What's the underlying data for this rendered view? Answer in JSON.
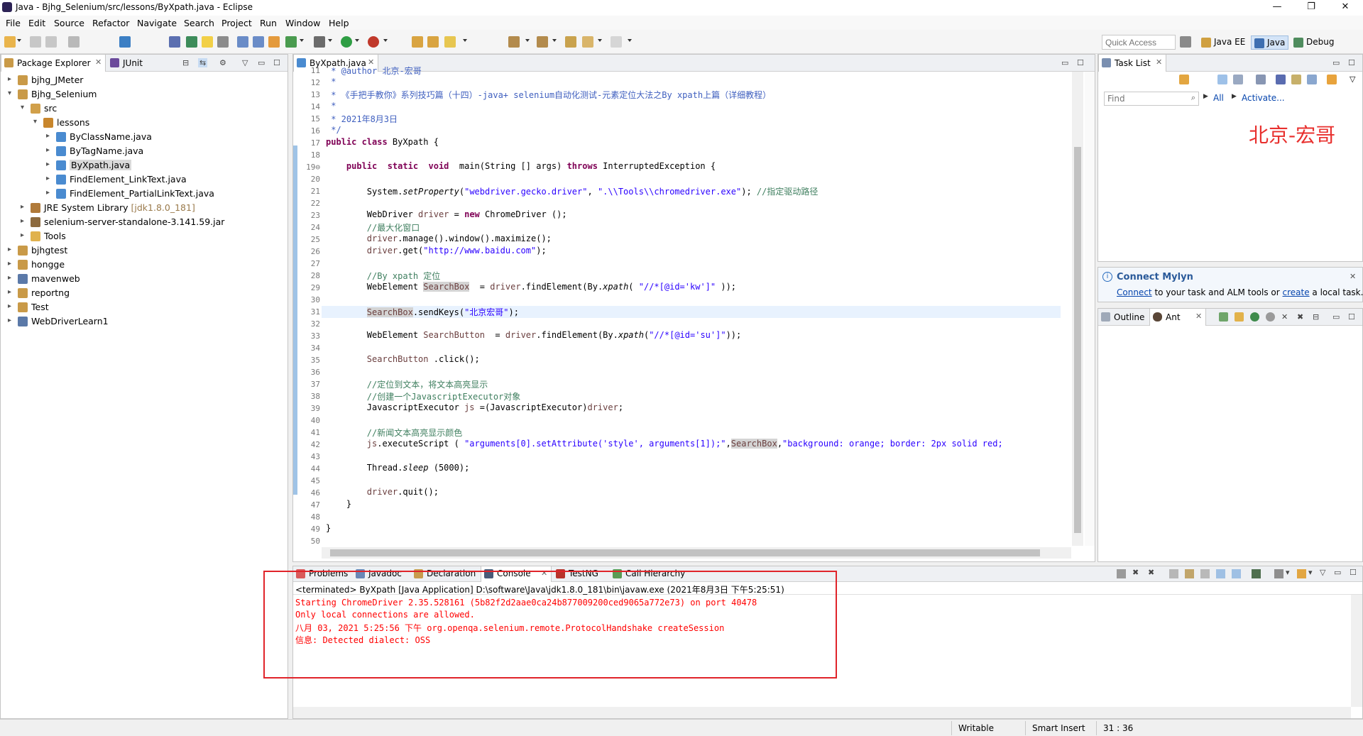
{
  "window": {
    "title": "Java - Bjhg_Selenium/src/lessons/ByXpath.java - Eclipse",
    "minimize": "—",
    "maximize": "❐",
    "close": "✕"
  },
  "menu": [
    "File",
    "Edit",
    "Source",
    "Refactor",
    "Navigate",
    "Search",
    "Project",
    "Run",
    "Window",
    "Help"
  ],
  "toolbar": {
    "quick_access_placeholder": "Quick Access",
    "perspectives": [
      "Java EE",
      "Java",
      "Debug"
    ]
  },
  "package_explorer": {
    "tabs": [
      "Package Explorer",
      "JUnit"
    ],
    "tree": [
      {
        "label": "bjhg_JMeter",
        "depth": 0,
        "expanded": false,
        "icon": "project-icon"
      },
      {
        "label": "Bjhg_Selenium",
        "depth": 0,
        "expanded": true,
        "icon": "project-icon"
      },
      {
        "label": "src",
        "depth": 1,
        "expanded": true,
        "icon": "source-folder-icon"
      },
      {
        "label": "lessons",
        "depth": 2,
        "expanded": true,
        "icon": "package-icon"
      },
      {
        "label": "ByClassName.java",
        "depth": 3,
        "expanded": false,
        "icon": "java-file-icon"
      },
      {
        "label": "ByTagName.java",
        "depth": 3,
        "expanded": false,
        "icon": "java-file-icon"
      },
      {
        "label": "ByXpath.java",
        "depth": 3,
        "expanded": false,
        "icon": "java-file-icon",
        "selected": true
      },
      {
        "label": "FindElement_LinkText.java",
        "depth": 3,
        "expanded": false,
        "icon": "java-file-icon"
      },
      {
        "label": "FindElement_PartialLinkText.java",
        "depth": 3,
        "expanded": false,
        "icon": "java-file-icon"
      },
      {
        "label": "JRE System Library",
        "decoration": "[jdk1.8.0_181]",
        "depth": 1,
        "expanded": false,
        "icon": "library-icon"
      },
      {
        "label": "selenium-server-standalone-3.141.59.jar",
        "depth": 1,
        "expanded": false,
        "icon": "jar-icon"
      },
      {
        "label": "Tools",
        "depth": 1,
        "expanded": false,
        "icon": "folder-icon"
      },
      {
        "label": "bjhgtest",
        "depth": 0,
        "expanded": false,
        "icon": "project-icon"
      },
      {
        "label": "hongge",
        "depth": 0,
        "expanded": false,
        "icon": "project-icon"
      },
      {
        "label": "mavenweb",
        "depth": 0,
        "expanded": false,
        "icon": "maven-project-icon"
      },
      {
        "label": "reportng",
        "depth": 0,
        "expanded": false,
        "icon": "project-icon"
      },
      {
        "label": "Test",
        "depth": 0,
        "expanded": false,
        "icon": "project-icon"
      },
      {
        "label": "WebDriverLearn1",
        "depth": 0,
        "expanded": false,
        "icon": "maven-project-icon"
      }
    ]
  },
  "editor": {
    "tab": "ByXpath.java",
    "current_line": 31,
    "lines": [
      {
        "n": "11",
        "parts": [
          [
            "jd",
            " * @author 北京-宏哥"
          ]
        ]
      },
      {
        "n": "12",
        "parts": [
          [
            "jd",
            " *"
          ]
        ]
      },
      {
        "n": "13",
        "parts": [
          [
            "jd",
            " * 《手把手教你》系列技巧篇（十四）-java+ selenium自动化测试-元素定位大法之By xpath上篇（详细教程）"
          ]
        ]
      },
      {
        "n": "14",
        "parts": [
          [
            "jd",
            " *"
          ]
        ]
      },
      {
        "n": "15",
        "parts": [
          [
            "jd",
            " * 2021年8月3日"
          ]
        ]
      },
      {
        "n": "16",
        "parts": [
          [
            "jd",
            " */"
          ]
        ]
      },
      {
        "n": "17",
        "parts": [
          [
            "kw",
            "public class"
          ],
          [
            "",
            " ByXpath {"
          ]
        ]
      },
      {
        "n": "18",
        "parts": []
      },
      {
        "n": "19⊖",
        "parts": [
          [
            "",
            "    "
          ],
          [
            "kw",
            "public  static  void"
          ],
          [
            "",
            "  main(String [] args) "
          ],
          [
            "kw",
            "throws"
          ],
          [
            "",
            " InterruptedException {"
          ]
        ]
      },
      {
        "n": "20",
        "parts": []
      },
      {
        "n": "21",
        "parts": [
          [
            "",
            "        System."
          ],
          [
            "it",
            "setProperty"
          ],
          [
            "",
            "("
          ],
          [
            "st",
            "\"webdriver.gecko.driver\""
          ],
          [
            "",
            ", "
          ],
          [
            "st",
            "\".\\\\Tools\\\\chromedriver.exe\""
          ],
          [
            "",
            "); "
          ],
          [
            "cm",
            "//指定驱动路径"
          ]
        ]
      },
      {
        "n": "22",
        "parts": []
      },
      {
        "n": "23",
        "parts": [
          [
            "",
            "        WebDriver "
          ],
          [
            "var",
            "driver"
          ],
          [
            "",
            " = "
          ],
          [
            "kw",
            "new"
          ],
          [
            "",
            " ChromeDriver ();"
          ]
        ]
      },
      {
        "n": "24",
        "parts": [
          [
            "",
            "        "
          ],
          [
            "cm",
            "//最大化窗口"
          ]
        ]
      },
      {
        "n": "25",
        "parts": [
          [
            "",
            "        "
          ],
          [
            "var",
            "driver"
          ],
          [
            "",
            ".manage().window().maximize();"
          ]
        ]
      },
      {
        "n": "26",
        "parts": [
          [
            "",
            "        "
          ],
          [
            "var",
            "driver"
          ],
          [
            "",
            ".get("
          ],
          [
            "st",
            "\"http://www.baidu.com\""
          ],
          [
            "",
            ");"
          ]
        ]
      },
      {
        "n": "27",
        "parts": []
      },
      {
        "n": "28",
        "parts": [
          [
            "",
            "        "
          ],
          [
            "cm",
            "//By xpath 定位"
          ]
        ]
      },
      {
        "n": "29",
        "parts": [
          [
            "",
            "        WebElement "
          ],
          [
            "varocc",
            "SearchBox"
          ],
          [
            "",
            "  = "
          ],
          [
            "var",
            "driver"
          ],
          [
            "",
            ".findElement(By."
          ],
          [
            "it",
            "xpath"
          ],
          [
            "",
            "( "
          ],
          [
            "st",
            "\"//*[@id='kw']\""
          ],
          [
            "",
            " ));"
          ]
        ]
      },
      {
        "n": "30",
        "parts": []
      },
      {
        "n": "31",
        "parts": [
          [
            "",
            "        "
          ],
          [
            "varocc",
            "SearchBox"
          ],
          [
            "",
            ".sendKeys("
          ],
          [
            "st",
            "\"北京宏哥\""
          ],
          [
            "",
            ");"
          ]
        ]
      },
      {
        "n": "32",
        "parts": []
      },
      {
        "n": "33",
        "parts": [
          [
            "",
            "        WebElement "
          ],
          [
            "var",
            "SearchButton"
          ],
          [
            "",
            "  = "
          ],
          [
            "var",
            "driver"
          ],
          [
            "",
            ".findElement(By."
          ],
          [
            "it",
            "xpath"
          ],
          [
            "",
            "("
          ],
          [
            "st",
            "\"//*[@id='su']\""
          ],
          [
            "",
            "));"
          ]
        ]
      },
      {
        "n": "34",
        "parts": []
      },
      {
        "n": "35",
        "parts": [
          [
            "",
            "        "
          ],
          [
            "var",
            "SearchButton"
          ],
          [
            "",
            " .click();"
          ]
        ]
      },
      {
        "n": "36",
        "parts": []
      },
      {
        "n": "37",
        "parts": [
          [
            "",
            "        "
          ],
          [
            "cm",
            "//定位到文本，将文本高亮显示"
          ]
        ]
      },
      {
        "n": "38",
        "parts": [
          [
            "",
            "        "
          ],
          [
            "cm",
            "//创建一个JavascriptExecutor对象"
          ]
        ]
      },
      {
        "n": "39",
        "parts": [
          [
            "",
            "        JavascriptExecutor "
          ],
          [
            "var",
            "js"
          ],
          [
            "",
            " =(JavascriptExecutor)"
          ],
          [
            "var",
            "driver"
          ],
          [
            "",
            ";"
          ]
        ]
      },
      {
        "n": "40",
        "parts": []
      },
      {
        "n": "41",
        "parts": [
          [
            "",
            "        "
          ],
          [
            "cm",
            "//新闻文本高亮显示颜色"
          ]
        ]
      },
      {
        "n": "42",
        "parts": [
          [
            "",
            "        "
          ],
          [
            "var",
            "js"
          ],
          [
            "",
            ".executeScript ( "
          ],
          [
            "st",
            "\"arguments[0].setAttribute('style', arguments[1]);\""
          ],
          [
            "",
            ","
          ],
          [
            "varocc",
            "SearchBox"
          ],
          [
            "",
            ","
          ],
          [
            "st",
            "\"background: orange; border: 2px solid red;"
          ]
        ]
      },
      {
        "n": "43",
        "parts": []
      },
      {
        "n": "44",
        "parts": [
          [
            "",
            "        Thread."
          ],
          [
            "it",
            "sleep"
          ],
          [
            "",
            " (5000);"
          ]
        ]
      },
      {
        "n": "45",
        "parts": []
      },
      {
        "n": "46",
        "parts": [
          [
            "",
            "        "
          ],
          [
            "var",
            "driver"
          ],
          [
            "",
            ".quit();"
          ]
        ]
      },
      {
        "n": "47",
        "parts": [
          [
            "",
            "    }"
          ]
        ]
      },
      {
        "n": "48",
        "parts": []
      },
      {
        "n": "49",
        "parts": [
          [
            "",
            "}"
          ]
        ]
      },
      {
        "n": "50",
        "parts": []
      }
    ]
  },
  "task_list": {
    "tab": "Task List",
    "find_placeholder": "Find",
    "all_label": "All",
    "activate_label": "Activate...",
    "watermark": "北京-宏哥"
  },
  "mylyn": {
    "title": "Connect Mylyn",
    "text_connect": "Connect",
    "text_middle": " to your task and ALM tools or ",
    "text_create": "create",
    "text_end": " a local task."
  },
  "outline": {
    "tabs": [
      "Outline",
      "Ant"
    ]
  },
  "console": {
    "tabs": [
      "Problems",
      "Javadoc",
      "Declaration",
      "Console",
      "TestNG",
      "Call Hierarchy"
    ],
    "header": "<terminated> ByXpath [Java Application] D:\\software\\Java\\jdk1.8.0_181\\bin\\javaw.exe (2021年8月3日 下午5:25:51)",
    "lines": [
      "Starting ChromeDriver 2.35.528161 (5b82f2d2aae0ca24b877009200ced9065a772e73) on port 40478",
      "Only local connections are allowed.",
      "八月 03, 2021 5:25:56 下午 org.openqa.selenium.remote.ProtocolHandshake createSession",
      "信息: Detected dialect: OSS"
    ],
    "highlight_color": "#e0242a"
  },
  "status": {
    "writable": "Writable",
    "insert_mode": "Smart Insert",
    "position": "31 : 36"
  }
}
